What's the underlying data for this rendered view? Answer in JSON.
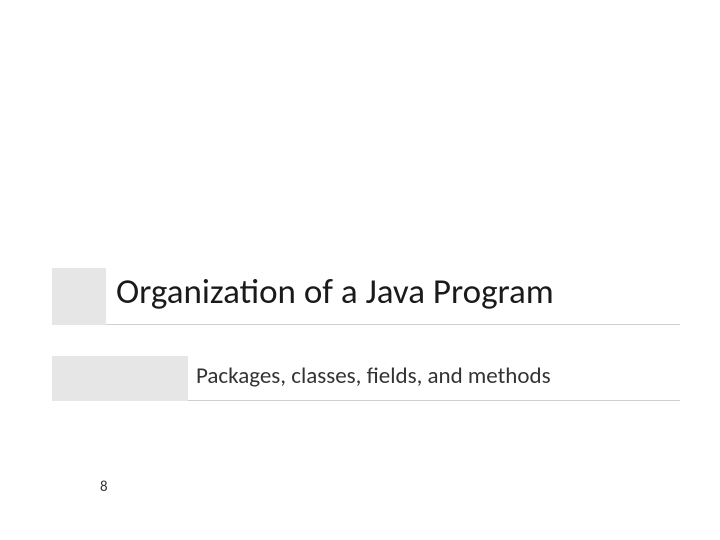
{
  "slide": {
    "title": "Organization of a Java Program",
    "subtitle": "Packages, classes, fields, and methods",
    "page_number": "8"
  }
}
